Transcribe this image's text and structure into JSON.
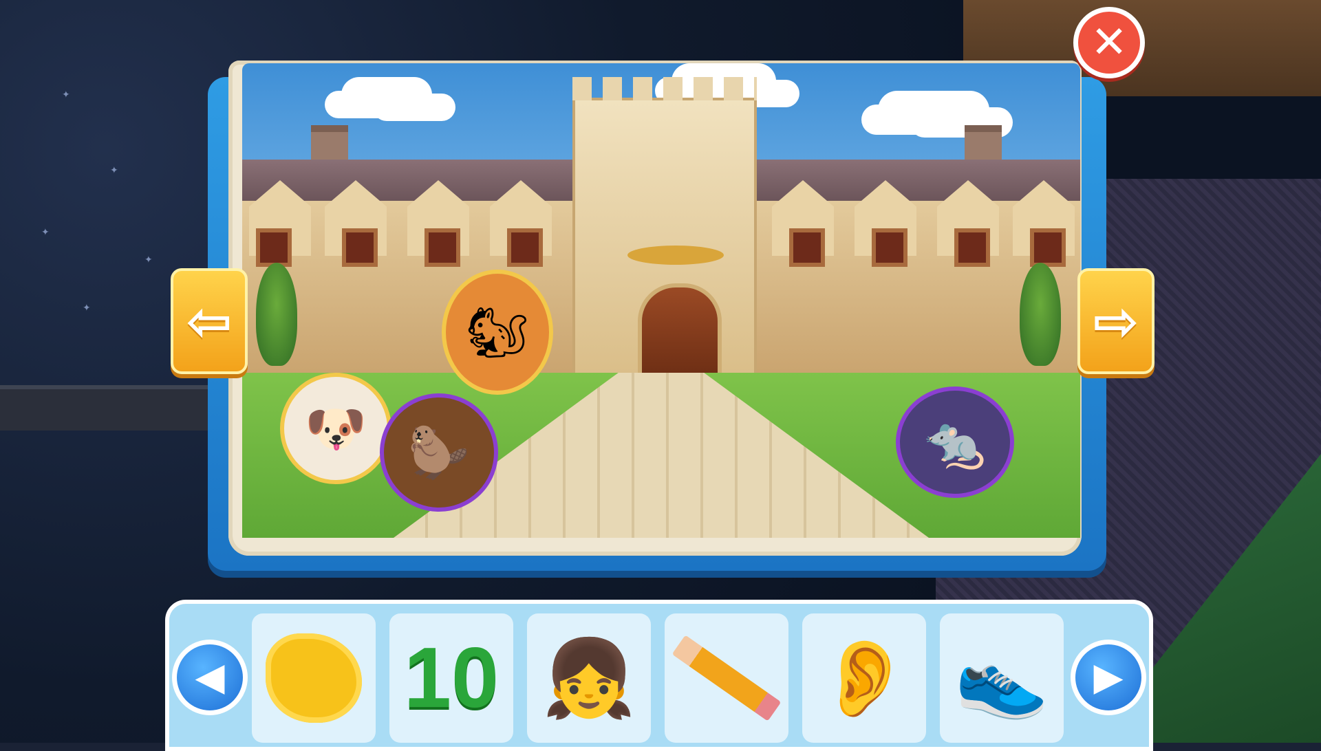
{
  "window": {
    "title": ""
  },
  "book": {
    "page_scene": "castle-courtyard",
    "stickers": [
      {
        "name": "chef-dog-sticker",
        "glyph": "🐶"
      },
      {
        "name": "squirrel-sticker",
        "glyph": "🐿"
      },
      {
        "name": "beaver-sticker",
        "glyph": "🦫"
      },
      {
        "name": "mole-sticker",
        "glyph": "🐀"
      }
    ]
  },
  "nav": {
    "prev_page_glyph": "⇦",
    "next_page_glyph": "⇨",
    "close_glyph": "✕"
  },
  "tray": {
    "prev_glyph": "◀",
    "next_glyph": "▶",
    "items": [
      {
        "name": "paint-splash",
        "icon": "splash-icon"
      },
      {
        "name": "number-ten",
        "label": "10"
      },
      {
        "name": "doll",
        "glyph": "👧"
      },
      {
        "name": "pencil",
        "icon": "pencil-icon"
      },
      {
        "name": "ear-sound",
        "glyph": "👂"
      },
      {
        "name": "sneakers",
        "glyph": "👟"
      }
    ]
  },
  "colors": {
    "accent_yellow": "#f3a21a",
    "close_red": "#f0513e",
    "book_blue": "#1b74c4",
    "tray_blue": "#a9dcf5"
  }
}
